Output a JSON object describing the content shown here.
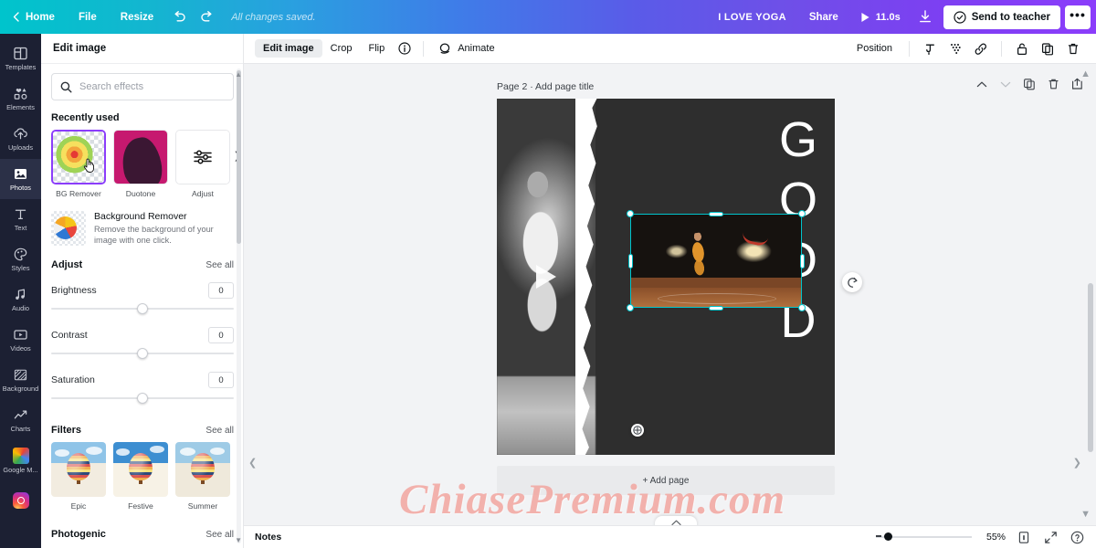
{
  "topbar": {
    "home_label": "Home",
    "file_label": "File",
    "resize_label": "Resize",
    "undo_icon": "undo-icon",
    "redo_icon": "redo-icon",
    "status": "All changes saved.",
    "design_title": "I LOVE YOGA",
    "share_label": "Share",
    "duration_label": "11.0s",
    "download_icon": "download-icon",
    "send_label": "Send to teacher",
    "more_label": "•••"
  },
  "rail": {
    "items": [
      {
        "label": "Templates",
        "icon": "templates-icon",
        "active": false
      },
      {
        "label": "Elements",
        "icon": "elements-icon",
        "active": false
      },
      {
        "label": "Uploads",
        "icon": "uploads-icon",
        "active": false
      },
      {
        "label": "Photos",
        "icon": "photos-icon",
        "active": true
      },
      {
        "label": "Text",
        "icon": "text-icon",
        "active": false
      },
      {
        "label": "Styles",
        "icon": "styles-icon",
        "active": false
      },
      {
        "label": "Audio",
        "icon": "audio-icon",
        "active": false
      },
      {
        "label": "Videos",
        "icon": "videos-icon",
        "active": false
      },
      {
        "label": "Background",
        "icon": "background-icon",
        "active": false
      },
      {
        "label": "Charts",
        "icon": "charts-icon",
        "active": false
      },
      {
        "label": "Google M...",
        "icon": "google-maps-icon",
        "active": false
      },
      {
        "label": "",
        "icon": "instagram-icon",
        "active": false
      }
    ]
  },
  "panel": {
    "title": "Edit image",
    "search_placeholder": "Search effects",
    "search_value": "",
    "recently_used_title": "Recently used",
    "effects": [
      {
        "label": "BG Remover",
        "selected": true
      },
      {
        "label": "Duotone",
        "selected": false
      },
      {
        "label": "Adjust",
        "selected": false
      }
    ],
    "bg_remover": {
      "title": "Background Remover",
      "description": "Remove the background of your image with one click."
    },
    "adjust": {
      "title": "Adjust",
      "see_all": "See all",
      "sliders": [
        {
          "label": "Brightness",
          "value": "0"
        },
        {
          "label": "Contrast",
          "value": "0"
        },
        {
          "label": "Saturation",
          "value": "0"
        }
      ]
    },
    "filters": {
      "title": "Filters",
      "see_all": "See all",
      "items": [
        {
          "label": "Epic"
        },
        {
          "label": "Festive"
        },
        {
          "label": "Summer"
        }
      ]
    },
    "photogenic": {
      "title": "Photogenic",
      "see_all": "See all"
    }
  },
  "editor_toolbar": {
    "edit_image": "Edit image",
    "crop": "Crop",
    "flip": "Flip",
    "info_icon": "info-icon",
    "animate": "Animate",
    "position": "Position",
    "icons": [
      "color-picker-icon",
      "transparency-icon",
      "link-icon",
      "lock-icon",
      "duplicate-icon",
      "delete-icon"
    ]
  },
  "canvas": {
    "page_label": "Page 2 · Add page title",
    "page_tools": [
      "move-page-up-icon",
      "move-page-down-icon",
      "duplicate-page-icon",
      "delete-page-icon",
      "add-page-icon"
    ],
    "text_overlay": [
      "G",
      "O",
      "O",
      "D"
    ],
    "selection_color": "#00c4cc",
    "add_page_label": "+ Add page",
    "watermark": "ChiasePremium.com"
  },
  "bottombar": {
    "notes_label": "Notes",
    "zoom_value": "55%",
    "page_manager_icon": "page-manager-icon",
    "fullscreen_icon": "fullscreen-icon",
    "help_icon": "help-icon"
  }
}
